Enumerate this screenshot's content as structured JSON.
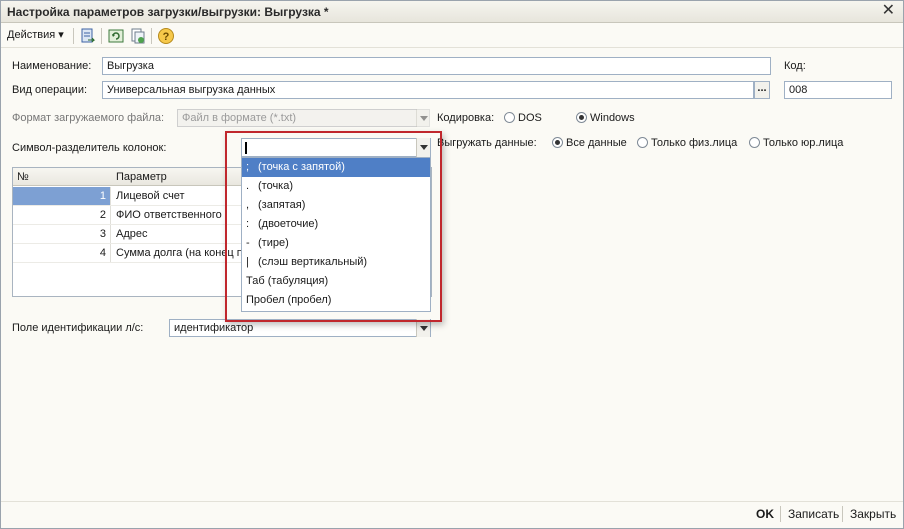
{
  "window": {
    "title": "Настройка параметров загрузки/выгрузки: Выгрузка *"
  },
  "toolbar": {
    "actions_label": "Действия",
    "help_label": "?"
  },
  "form": {
    "name_label": "Наименование:",
    "name_value": "Выгрузка",
    "code_label": "Код:",
    "operation_label": "Вид операции:",
    "operation_value": "Универсальная выгрузка данных",
    "code_value": "008",
    "file_format_label": "Формат загружаемого файла:",
    "file_format_value": "Файл в формате (*.txt)",
    "encoding_label": "Кодировка:",
    "encoding_options": [
      "DOS",
      "Windows"
    ],
    "encoding_selected": "Windows",
    "separator_label": "Символ-разделитель колонок:",
    "export_label": "Выгружать данные:",
    "export_options": [
      "Все данные",
      "Только физ.лица",
      "Только юр.лица"
    ],
    "export_selected": "Все данные",
    "id_field_label": "Поле идентификации л/с:",
    "id_field_value": "идентификатор"
  },
  "grid": {
    "columns": [
      "№",
      "Параметр"
    ],
    "rows": [
      {
        "num": "1",
        "param": "Лицевой счет"
      },
      {
        "num": "2",
        "param": "ФИО ответственного"
      },
      {
        "num": "3",
        "param": "Адрес"
      },
      {
        "num": "4",
        "param": "Сумма долга (на конец п"
      }
    ]
  },
  "separator_dropdown": {
    "current_value": "",
    "items": [
      {
        "symbol": ";",
        "label": "(точка с запятой)"
      },
      {
        "symbol": ".",
        "label": "(точка)"
      },
      {
        "symbol": ",",
        "label": "(запятая)"
      },
      {
        "symbol": ":",
        "label": "(двоеточие)"
      },
      {
        "symbol": "-",
        "label": "(тире)"
      },
      {
        "symbol": "|",
        "label": "(слэш вертикальный)"
      },
      {
        "symbol": "",
        "label": "Таб (табуляция)"
      },
      {
        "symbol": "",
        "label": "Пробел (пробел)"
      }
    ],
    "selected_index": 0
  },
  "footer": {
    "ok": "OK",
    "save": "Записать",
    "close": "Закрыть"
  },
  "colors": {
    "selection": "#4f7fc6",
    "highlight_frame": "#c0272d"
  }
}
